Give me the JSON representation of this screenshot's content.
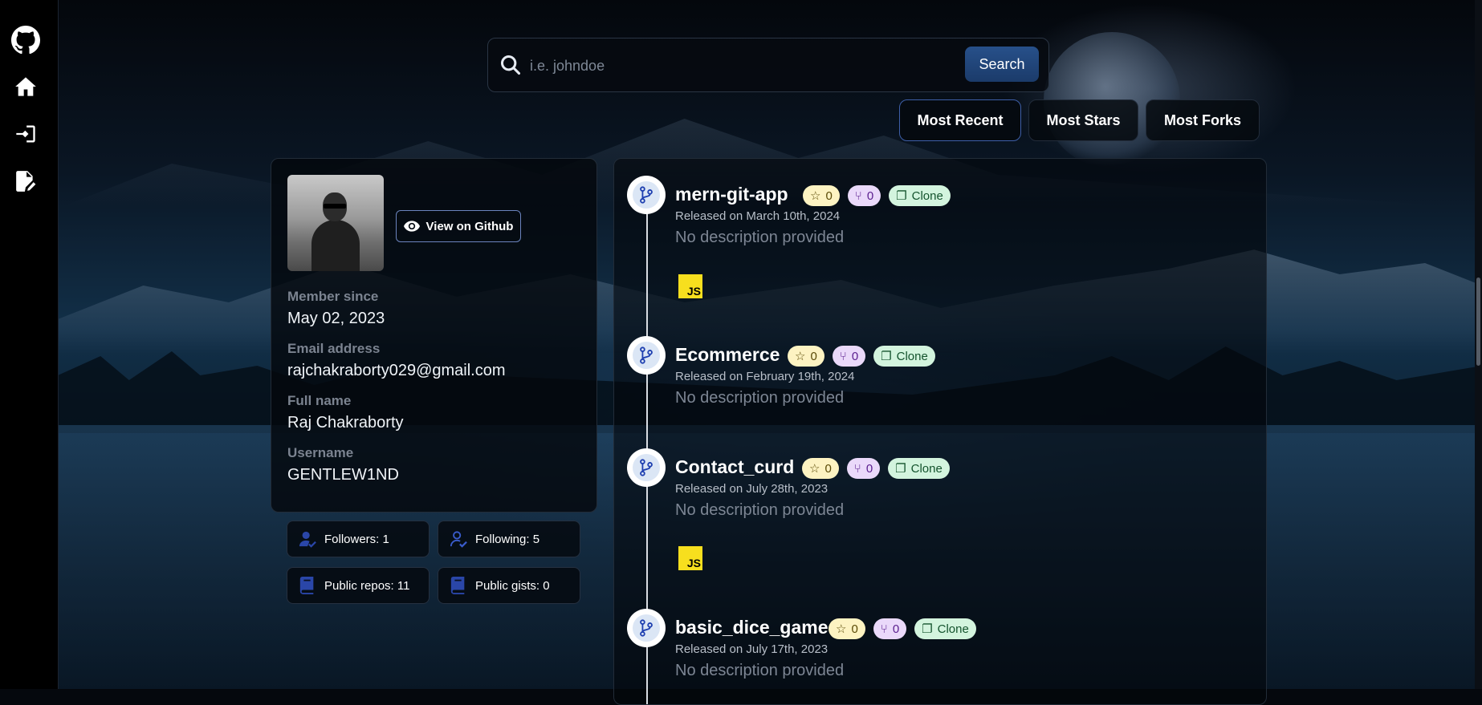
{
  "sidebar": {
    "icons": [
      "github-icon",
      "home-icon",
      "login-icon",
      "signup-icon"
    ]
  },
  "search": {
    "placeholder": "i.e. johndoe",
    "value": "",
    "button_label": "Search"
  },
  "sort_buttons": [
    {
      "label": "Most Recent",
      "active": true
    },
    {
      "label": "Most Stars",
      "active": false
    },
    {
      "label": "Most Forks",
      "active": false
    }
  ],
  "profile": {
    "view_button": "View on Github",
    "fields": [
      {
        "label": "Member since",
        "value": "May 02, 2023"
      },
      {
        "label": "Email address",
        "value": "rajchakraborty029@gmail.com"
      },
      {
        "label": "Full name",
        "value": "Raj Chakraborty"
      },
      {
        "label": "Username",
        "value": "GENTLEW1ND"
      }
    ]
  },
  "stats": [
    {
      "label": "Followers: 1",
      "icon": "followers-icon"
    },
    {
      "label": "Following: 5",
      "icon": "following-icon"
    },
    {
      "label": "Public repos: 11",
      "icon": "repo-icon"
    },
    {
      "label": "Public gists: 0",
      "icon": "gist-icon"
    }
  ],
  "repos": [
    {
      "name": "mern-git-app",
      "stars": "0",
      "forks": "0",
      "clone_label": "Clone",
      "released": "Released on March 10th, 2024",
      "description": "No description provided",
      "language": "JS"
    },
    {
      "name": "Ecommerce",
      "stars": "0",
      "forks": "0",
      "clone_label": "Clone",
      "released": "Released on February 19th, 2024",
      "description": "No description provided",
      "language": ""
    },
    {
      "name": "Contact_curd",
      "stars": "0",
      "forks": "0",
      "clone_label": "Clone",
      "released": "Released on July 28th, 2023",
      "description": "No description provided",
      "language": "JS"
    },
    {
      "name": "basic_dice_game",
      "stars": "0",
      "forks": "0",
      "clone_label": "Clone",
      "released": "Released on July 17th, 2023",
      "description": "No description provided",
      "language": ""
    }
  ],
  "colors": {
    "accent": "#27508a",
    "star_badge": "#fdf3c2",
    "fork_badge": "#ead9fa",
    "clone_badge": "#d3f4de",
    "js_badge": "#f7df1e"
  }
}
